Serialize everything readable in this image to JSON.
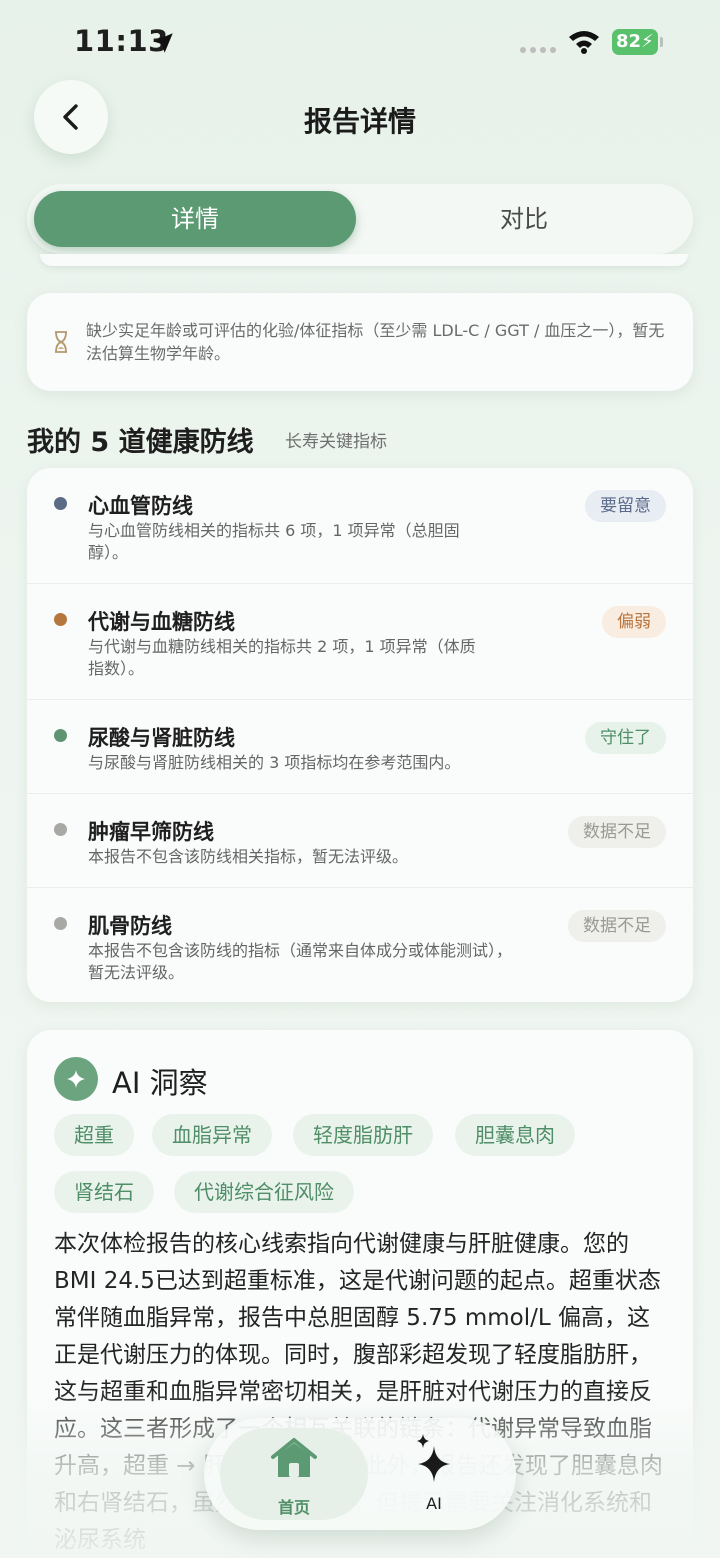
{
  "status": {
    "time": "11:13",
    "battery": "82"
  },
  "header": {
    "title": "报告详情"
  },
  "segment": {
    "details": "详情",
    "compare": "对比"
  },
  "notice": {
    "text": "缺少实足年龄或可评估的化验/体征指标（至少需 LDL-C / GGT / 血压之一），暂无法估算生物学年龄。"
  },
  "section": {
    "title": "我的 5 道健康防线",
    "subtitle": "长寿关键指标"
  },
  "defenses": [
    {
      "title": "心血管防线",
      "desc": "与心血管防线相关的指标共 6 项，1 项异常（总胆固醇）。",
      "badge": "要留意",
      "dot_color": "#5b6b86",
      "badge_bg": "#e8ecf3",
      "badge_color": "#5a6b8c"
    },
    {
      "title": "代谢与血糖防线",
      "desc": "与代谢与血糖防线相关的指标共 2 项，1 项异常（体质指数）。",
      "badge": "偏弱",
      "dot_color": "#b5773d",
      "badge_bg": "#f9ece0",
      "badge_color": "#b8753e"
    },
    {
      "title": "尿酸与肾脏防线",
      "desc": "与尿酸与肾脏防线相关的 3 项指标均在参考范围内。",
      "badge": "守住了",
      "dot_color": "#5f9473",
      "badge_bg": "#e7f2ea",
      "badge_color": "#4f8e66"
    },
    {
      "title": "肿瘤早筛防线",
      "desc": "本报告不包含该防线相关指标，暂无法评级。",
      "badge": "数据不足",
      "dot_color": "#a8a8a4",
      "badge_bg": "#efefeb",
      "badge_color": "#9a9a95"
    },
    {
      "title": "肌骨防线",
      "desc": "本报告不包含该防线的指标（通常来自体成分或体能测试），暂无法评级。",
      "badge": "数据不足",
      "dot_color": "#a8a8a4",
      "badge_bg": "#efefeb",
      "badge_color": "#9a9a95"
    }
  ],
  "ai": {
    "title": "AI 洞察",
    "tags": [
      "超重",
      "血脂异常",
      "轻度脂肪肝",
      "胆囊息肉",
      "肾结石",
      "代谢综合征风险"
    ],
    "body": "本次体检报告的核心线索指向代谢健康与肝脏健康。您的BMI 24.5已达到超重标准，这是代谢问题的起点。超重状态常伴随血脂异常，报告中总胆固醇 5.75 mmol/L 偏高，这正是代谢压力的体现。同时，腹部彩超发现了轻度脂肪肝，这与超重和血脂异常密切相关，是肝脏对代谢压力的直接反应。这三者形成了一个相互关联的链条：代谢异常导致血脂升高，超重 → 肝脏脂肪堆积。此外，报告还发现了胆囊息肉和右肾结石，虽然目前无症状，但提示需要关注消化系统和泌尿系统"
  },
  "tabbar": {
    "home": "首页",
    "ai": "AI"
  },
  "colors": {
    "accent": "#5b9a73"
  }
}
